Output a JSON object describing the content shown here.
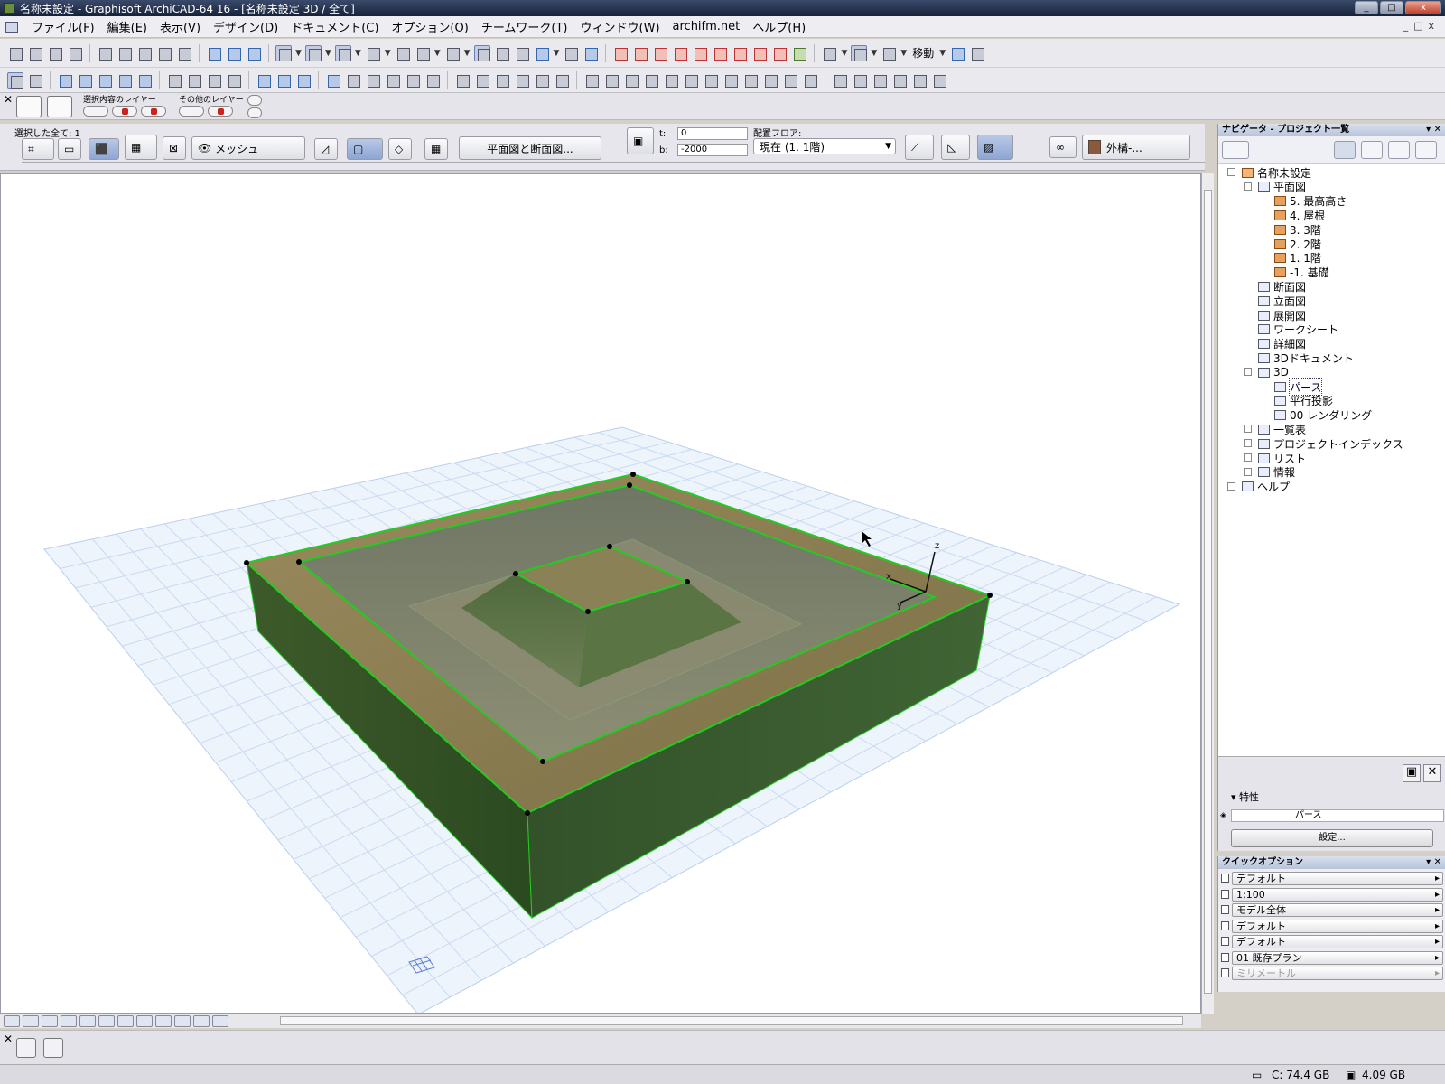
{
  "window": {
    "title": "名称未設定 - Graphisoft ArchiCAD-64 16 - [名称未設定 3D / 全て]",
    "min": "_",
    "max": "□",
    "close": "x"
  },
  "menu": [
    "ファイル(F)",
    "編集(E)",
    "表示(V)",
    "デザイン(D)",
    "ドキュメント(C)",
    "オプション(O)",
    "チームワーク(T)",
    "ウィンドウ(W)",
    "archifm.net",
    "ヘルプ(H)"
  ],
  "toolbar": {
    "move_label": "移動"
  },
  "layer_row": {
    "selected_layers_label": "選択内容のレイヤー",
    "other_layers_label": "その他のレイヤー"
  },
  "infobox": {
    "selection_count": "選択した全て: 1",
    "element_type": "メッシュ",
    "plan_section_button": "平面図と断面図...",
    "t_label": "t:",
    "t_value": "0",
    "b_label": "b:",
    "b_value": "-2000",
    "floor_label": "配置フロア:",
    "floor_value": "現在 (1. 1階)",
    "material": "外構-..."
  },
  "navigator": {
    "title": "ナビゲータ - プロジェクト一覧",
    "tree": [
      {
        "label": "名称未設定",
        "depth": 0,
        "icon": "home",
        "expand": "-"
      },
      {
        "label": "平面図",
        "depth": 1,
        "icon": "plan",
        "expand": "-"
      },
      {
        "label": "5. 最高高さ",
        "depth": 2,
        "icon": "folder"
      },
      {
        "label": "4. 屋根",
        "depth": 2,
        "icon": "folder"
      },
      {
        "label": "3. 3階",
        "depth": 2,
        "icon": "folder"
      },
      {
        "label": "2. 2階",
        "depth": 2,
        "icon": "folder"
      },
      {
        "label": "1. 1階",
        "depth": 2,
        "icon": "folder"
      },
      {
        "label": "-1. 基礎",
        "depth": 2,
        "icon": "folder"
      },
      {
        "label": "断面図",
        "depth": 1,
        "icon": "doc"
      },
      {
        "label": "立面図",
        "depth": 1,
        "icon": "doc"
      },
      {
        "label": "展開図",
        "depth": 1,
        "icon": "doc"
      },
      {
        "label": "ワークシート",
        "depth": 1,
        "icon": "doc"
      },
      {
        "label": "詳細図",
        "depth": 1,
        "icon": "doc"
      },
      {
        "label": "3Dドキュメント",
        "depth": 1,
        "icon": "doc"
      },
      {
        "label": "3D",
        "depth": 1,
        "icon": "doc",
        "expand": "-"
      },
      {
        "label": "パース",
        "depth": 2,
        "icon": "camera",
        "selected": true
      },
      {
        "label": "平行投影",
        "depth": 2,
        "icon": "box"
      },
      {
        "label": "00 レンダリング",
        "depth": 2,
        "icon": "render"
      },
      {
        "label": "一覧表",
        "depth": 1,
        "icon": "doc",
        "expand": "+"
      },
      {
        "label": "プロジェクトインデックス",
        "depth": 1,
        "icon": "doc",
        "expand": "+"
      },
      {
        "label": "リスト",
        "depth": 1,
        "icon": "doc",
        "expand": "+"
      },
      {
        "label": "情報",
        "depth": 1,
        "icon": "doc",
        "expand": "+"
      },
      {
        "label": "ヘルプ",
        "depth": 0,
        "icon": "doc",
        "expand": "+"
      }
    ]
  },
  "properties": {
    "title": "特性",
    "value": "パース",
    "settings_button": "設定..."
  },
  "quick_options": {
    "title": "クイックオプション",
    "rows": [
      {
        "label": "デフォルト"
      },
      {
        "label": "1:100"
      },
      {
        "label": "モデル全体"
      },
      {
        "label": "デフォルト"
      },
      {
        "label": "デフォルト"
      },
      {
        "label": "01 既存プラン"
      },
      {
        "label": "ミリメートル",
        "disabled": true
      }
    ]
  },
  "status": {
    "disk_c": "C: 74.4 GB",
    "memory": "4.09 GB"
  },
  "axes": {
    "x": "x",
    "y": "y",
    "z": "z"
  },
  "colors": {
    "selection_green": "#22cc22",
    "terrain_top": "#8b7d52",
    "terrain_side": "#3c5a2a",
    "grid_line": "#b9cfec"
  }
}
